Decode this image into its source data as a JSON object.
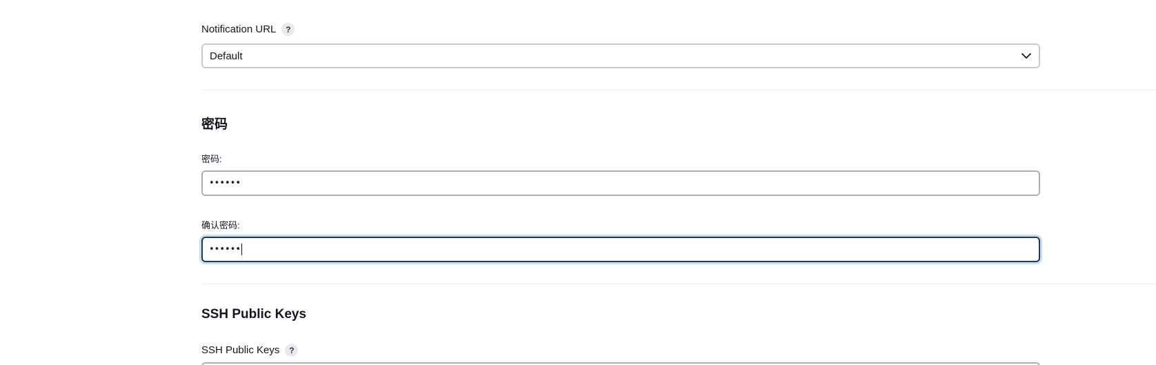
{
  "notification_url": {
    "label": "Notification URL",
    "help": "?",
    "selected": "Default"
  },
  "password_section": {
    "title": "密码",
    "password_label": "密码:",
    "password_value": "••••••",
    "confirm_label": "确认密码:",
    "confirm_value": "••••••"
  },
  "ssh_section": {
    "title": "SSH Public Keys",
    "field_label": "SSH Public Keys",
    "help": "?"
  },
  "icons": {
    "help": "question-mark-icon",
    "select": "chevron-down-icon"
  }
}
